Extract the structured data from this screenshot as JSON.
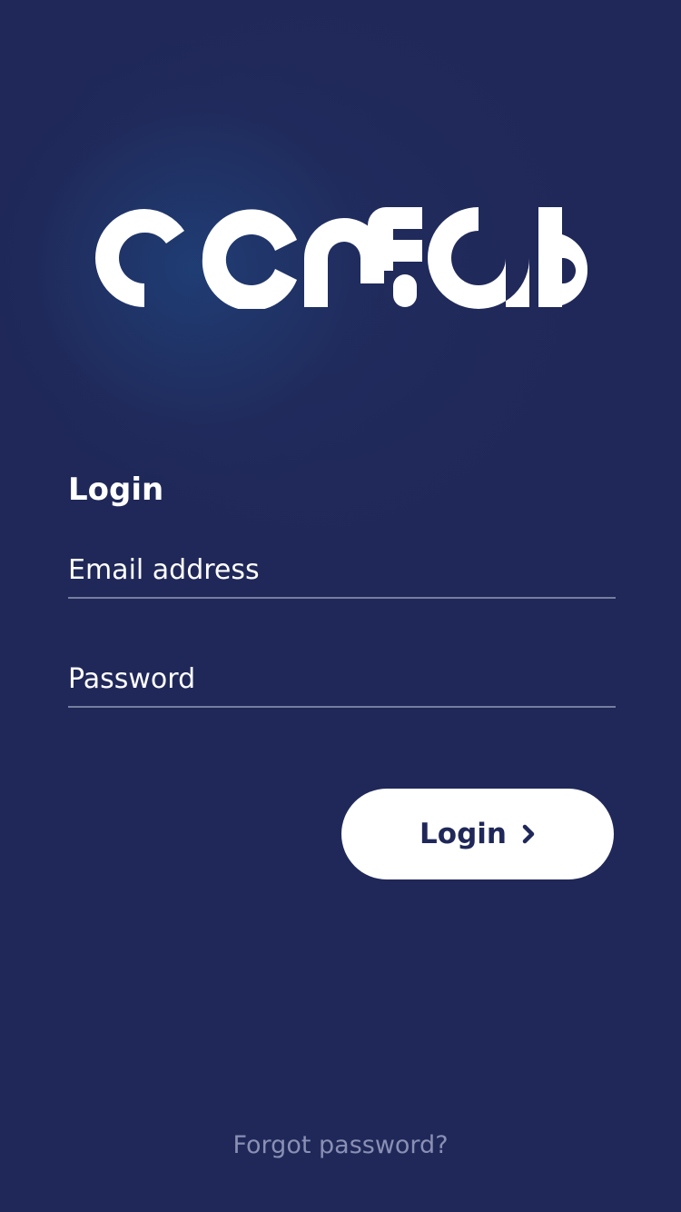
{
  "brand": {
    "logo_text": "confab"
  },
  "login": {
    "title": "Login",
    "email_placeholder": "Email address",
    "email_value": "",
    "password_placeholder": "Password",
    "password_value": "",
    "button_label": "Login",
    "button_icon": "chevron-right-icon",
    "forgot_link": "Forgot password?"
  },
  "colors": {
    "background": "#1f2858",
    "button_background": "#ffffff",
    "button_text": "#1f2858",
    "link_text": "#8a90b4"
  }
}
